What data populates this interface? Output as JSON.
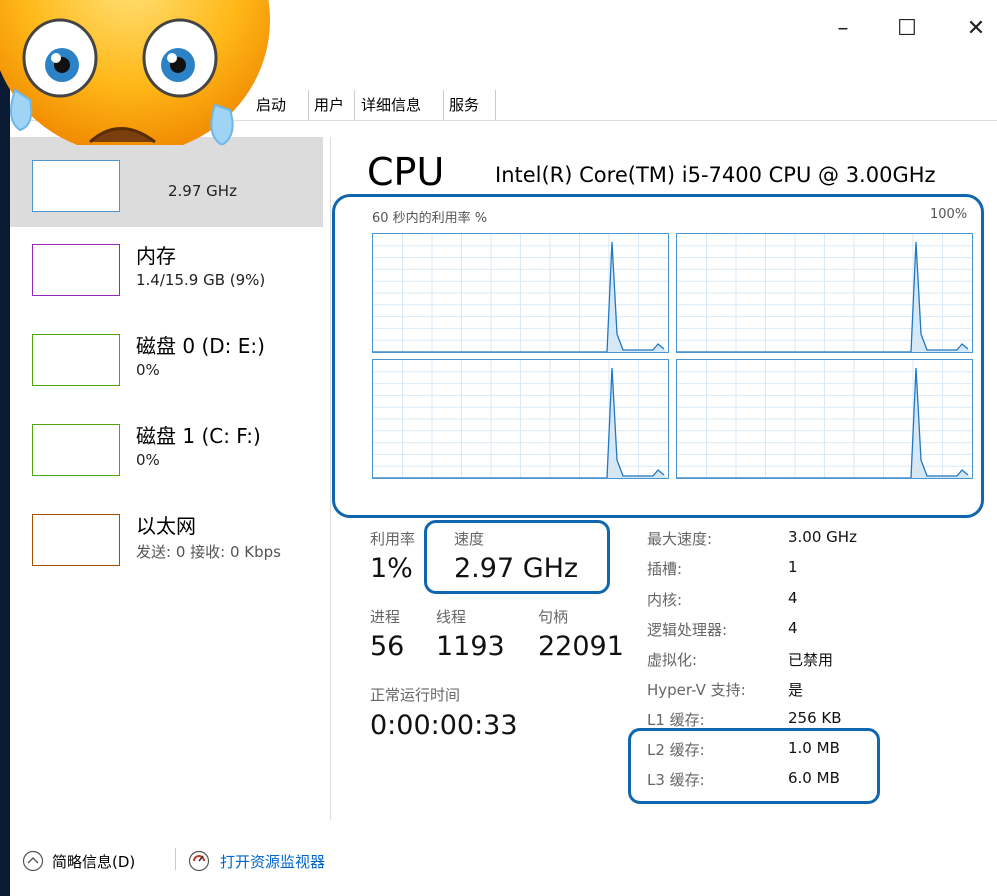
{
  "window": {
    "minimize_label": "–",
    "maximize_label": "☐",
    "close_label": "✕"
  },
  "tabs": [
    "启动",
    "用户",
    "详细信息",
    "服务"
  ],
  "sidebar": {
    "cpu": {
      "value": "2.97 GHz"
    },
    "memory": {
      "name": "内存",
      "value": "1.4/15.9 GB (9%)"
    },
    "disk0": {
      "name": "磁盘 0 (D: E:)",
      "value": "0%"
    },
    "disk1": {
      "name": "磁盘 1 (C: F:)",
      "value": "0%"
    },
    "ethernet": {
      "name": "以太网",
      "value": "发送: 0 接收: 0 Kbps"
    }
  },
  "cpu": {
    "title": "CPU",
    "model": "Intel(R) Core(TM) i5-7400 CPU @ 3.00GHz",
    "graph_label": "60 秒内的利用率 %",
    "graph_max": "100%"
  },
  "stats": {
    "utilization_label": "利用率",
    "utilization": "1%",
    "speed_label": "速度",
    "speed": "2.97 GHz",
    "processes_label": "进程",
    "processes": "56",
    "threads_label": "线程",
    "threads": "1193",
    "handles_label": "句柄",
    "handles": "22091",
    "uptime_label": "正常运行时间",
    "uptime": "0:00:00:33"
  },
  "details": [
    {
      "label": "最大速度:",
      "value": "3.00 GHz"
    },
    {
      "label": "插槽:",
      "value": "1"
    },
    {
      "label": "内核:",
      "value": "4"
    },
    {
      "label": "逻辑处理器:",
      "value": "4"
    },
    {
      "label": "虚拟化:",
      "value": "已禁用"
    },
    {
      "label": "Hyper-V 支持:",
      "value": "是"
    },
    {
      "label": "L1 缓存:",
      "value": "256 KB"
    },
    {
      "label": "L2 缓存:",
      "value": "1.0 MB"
    },
    {
      "label": "L3 缓存:",
      "value": "6.0 MB"
    }
  ],
  "footer": {
    "less_details": "简略信息(D)",
    "resource_monitor": "打开资源监视器"
  },
  "colors": {
    "accent": "#1166b0",
    "cpu_line": "#4d95cf",
    "memory": "#9528b4",
    "disk": "#4da60c",
    "ethernet": "#a74f01"
  }
}
